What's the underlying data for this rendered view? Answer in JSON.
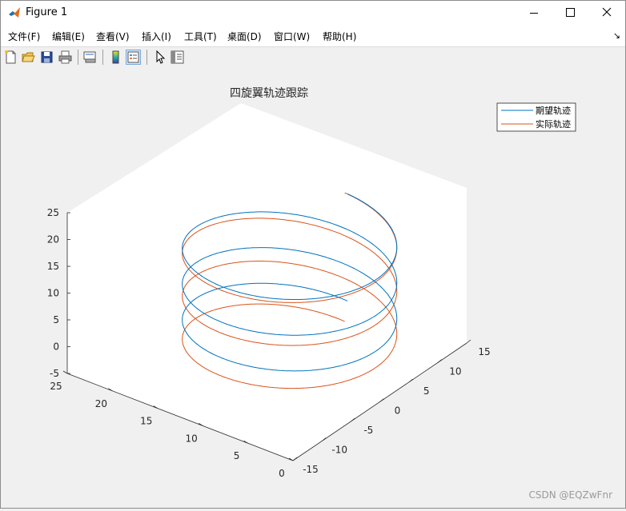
{
  "window": {
    "title": "Figure 1"
  },
  "menu": [
    {
      "label": "文件(F)"
    },
    {
      "label": "编辑(E)"
    },
    {
      "label": "查看(V)"
    },
    {
      "label": "插入(I)"
    },
    {
      "label": "工具(T)"
    },
    {
      "label": "桌面(D)"
    },
    {
      "label": "窗口(W)"
    },
    {
      "label": "帮助(H)"
    }
  ],
  "toolbar": {
    "icons": [
      "new-figure-icon",
      "open-file-icon",
      "save-icon",
      "print-icon",
      "link-plot-icon",
      "insert-colorbar-icon",
      "insert-legend-icon",
      "edit-plot-arrow-icon",
      "property-inspector-icon"
    ]
  },
  "colors": {
    "series1": "#0072BD",
    "series2": "#D95319",
    "axes_face": "#ffffff",
    "figure_bg": "#f0f0f0"
  },
  "chart_data": {
    "type": "line",
    "title": "四旋翼轨迹跟踪",
    "view": "3d",
    "xlim": [
      -15,
      15
    ],
    "ylim": [
      0,
      25
    ],
    "zlim": [
      -5,
      25
    ],
    "xticks": [
      "-15",
      "-10",
      "-5",
      "0",
      "5",
      "10",
      "15"
    ],
    "yticks": [
      "0",
      "5",
      "10",
      "15",
      "20",
      "25"
    ],
    "zticks": [
      "-5",
      "0",
      "5",
      "10",
      "15",
      "20",
      "25"
    ],
    "legend": {
      "placement": "top-right",
      "entries": [
        "期望轨迹",
        "实际轨迹"
      ]
    },
    "grid": false,
    "series": [
      {
        "name": "期望轨迹",
        "description": "helix x=cos, y=sin, z=t",
        "x_range": [
          -10,
          10
        ],
        "y_range": [
          0,
          20
        ],
        "z_range": [
          0,
          20
        ],
        "turns": 3
      },
      {
        "name": "实际轨迹",
        "description": "helix tracking desired",
        "x_range": [
          -10,
          10
        ],
        "y_range": [
          0,
          20
        ],
        "z_range": [
          -4,
          20
        ],
        "turns": 3
      }
    ]
  },
  "watermark": "CSDN @EQZwFnr"
}
